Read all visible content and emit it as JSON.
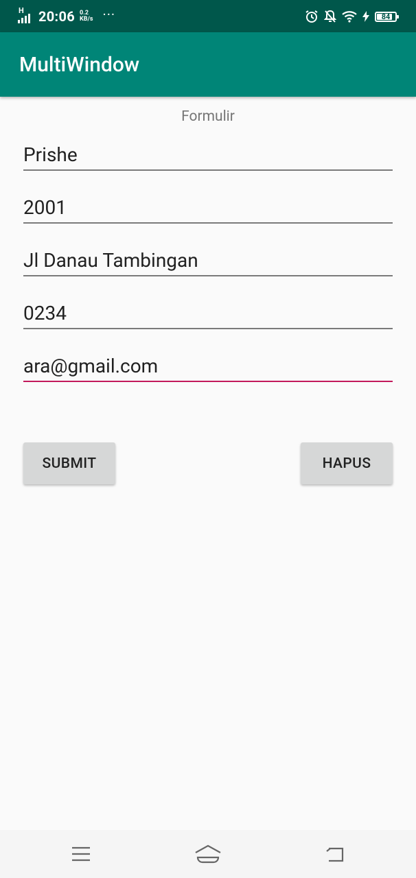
{
  "status_bar": {
    "network_type": "H",
    "time": "20:06",
    "speed_value": "0.2",
    "speed_unit": "KB/s",
    "more_dots": "···",
    "battery_level": "84",
    "battery_percent": 84,
    "icons": [
      "signal-icon",
      "alarm-icon",
      "notifications-off-icon",
      "wifi-icon",
      "charging-icon",
      "battery-icon"
    ]
  },
  "app_bar": {
    "title": "MultiWindow",
    "color": "#008577"
  },
  "form": {
    "title": "Formulir",
    "fields": [
      {
        "value": "Prishe"
      },
      {
        "value": "2001"
      },
      {
        "value": "Jl Danau Tambingan"
      },
      {
        "value": "0234"
      },
      {
        "value": "ara@gmail.com",
        "focused": true
      }
    ],
    "submit_label": "SUBMIT",
    "clear_label": "HAPUS",
    "accent_color": "#c2185b"
  },
  "nav_bar": {
    "icons": [
      "menu-icon",
      "home-icon",
      "back-icon"
    ]
  }
}
